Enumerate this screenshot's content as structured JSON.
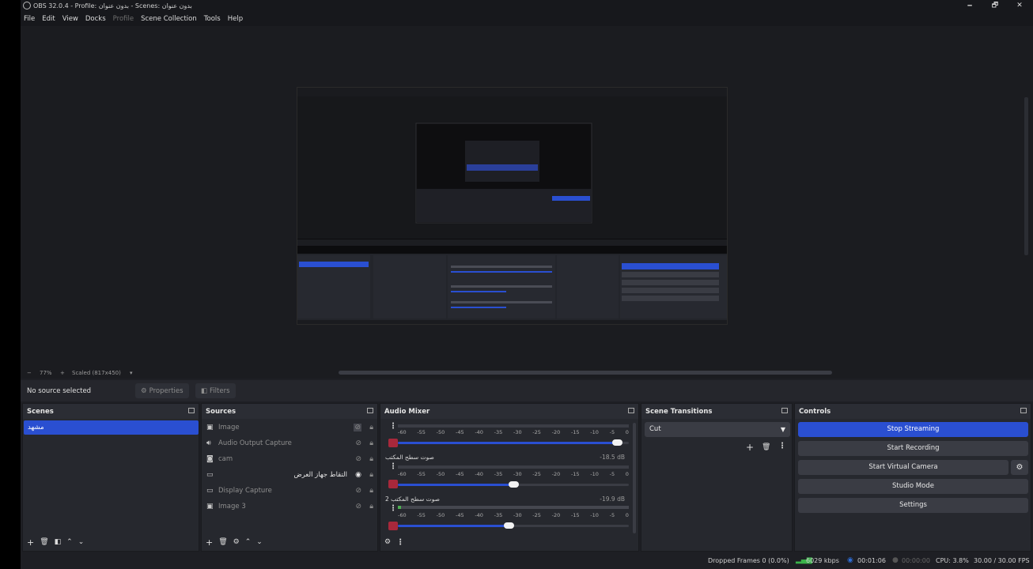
{
  "window": {
    "title": "OBS 32.0.4 - Profile: بدون عنوان - Scenes: بدون عنوان",
    "minimize": "🗕",
    "maximize": "🗗",
    "close": "✕"
  },
  "menu": [
    "File",
    "Edit",
    "View",
    "Docks",
    "Profile",
    "Scene Collection",
    "Tools",
    "Help"
  ],
  "zoom": {
    "minus": "−",
    "level": "77%",
    "plus": "+",
    "scale_mode": "Scaled (817x450)",
    "chevron": "▾"
  },
  "context_bar": {
    "status": "No source selected",
    "properties_label": "Properties",
    "filters_label": "Filters"
  },
  "scenes": {
    "title": "Scenes",
    "items": [
      {
        "label": "مشهد",
        "selected": true
      }
    ]
  },
  "sources": {
    "title": "Sources",
    "items": [
      {
        "label": "Image",
        "icon": "image-icon",
        "visible": false,
        "rtl": false
      },
      {
        "label": "Audio Output Capture",
        "icon": "speaker-icon",
        "visible": false,
        "rtl": false
      },
      {
        "label": "cam",
        "icon": "camera-icon",
        "visible": false,
        "rtl": false
      },
      {
        "label": "التقاط جهاز العرض",
        "icon": "monitor-icon",
        "visible": true,
        "rtl": true
      },
      {
        "label": "Display Capture",
        "icon": "monitor-icon",
        "visible": false,
        "rtl": false
      },
      {
        "label": "Image 3",
        "icon": "image-icon",
        "visible": false,
        "rtl": false
      }
    ]
  },
  "audio_mixer": {
    "title": "Audio Mixer",
    "scale_ticks": [
      "-60",
      "-55",
      "-50",
      "-45",
      "-40",
      "-35",
      "-30",
      "-25",
      "-20",
      "-15",
      "-10",
      "-5",
      "0"
    ],
    "channels": [
      {
        "name": "",
        "db": "",
        "level": 0.97
      },
      {
        "name": "صوت سطح المكتب",
        "db": "-18.5 dB",
        "level": 0.5
      },
      {
        "name": "صوت سطح المكتب 2",
        "db": "-19.9 dB",
        "level": 0.48
      }
    ]
  },
  "scene_transitions": {
    "title": "Scene Transitions",
    "selected": "Cut"
  },
  "controls": {
    "title": "Controls",
    "buttons": [
      "Stop Streaming",
      "Start Recording",
      "Start Virtual Camera",
      "Studio Mode",
      "Settings"
    ]
  },
  "status": {
    "dropped_frames": "Dropped Frames 0 (0.0%)",
    "bitrate": "6029 kbps",
    "stream_time": "00:01:06",
    "rec_time": "00:00:00",
    "cpu": "CPU: 3.8%",
    "fps": "30.00 / 30.00 FPS"
  },
  "colors": {
    "accent": "#2a4fd1",
    "mute_red": "#a8283b",
    "meter_green": "#4caf50",
    "bitrate_green": "#3bb34a"
  }
}
